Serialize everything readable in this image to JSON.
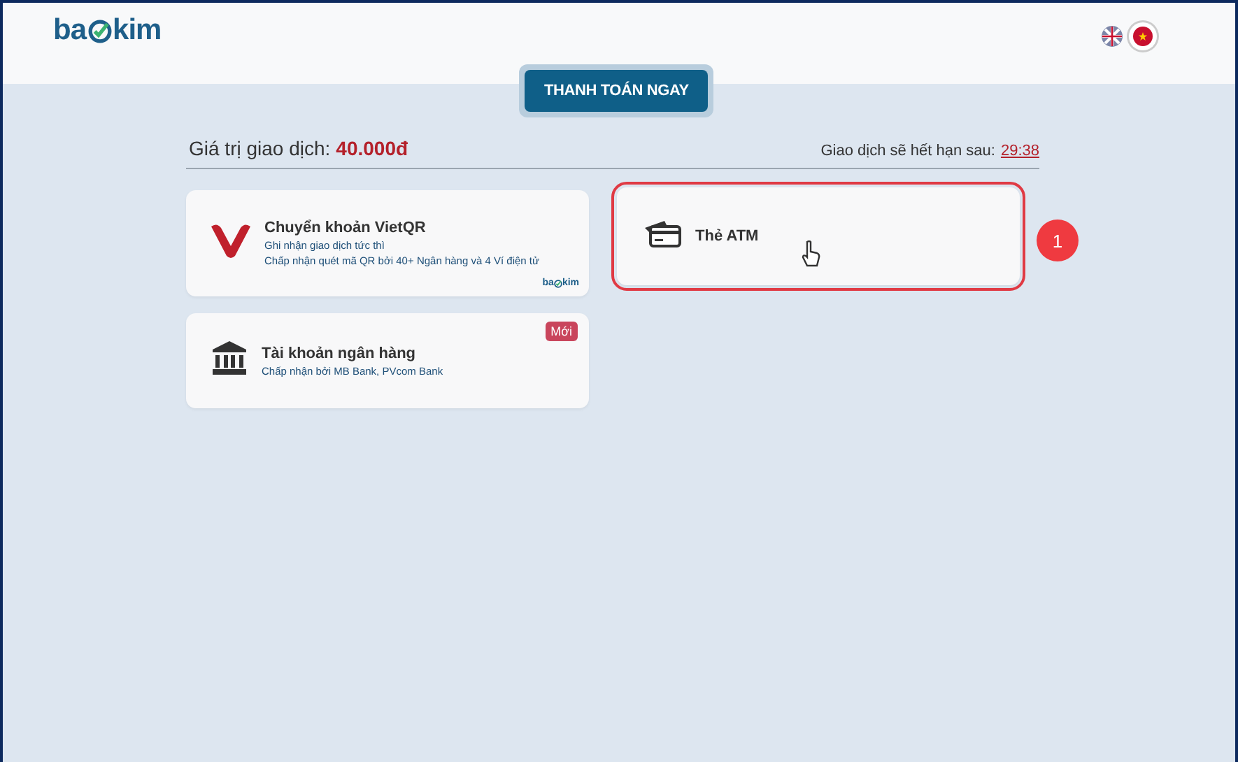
{
  "logo": {
    "before": "ba",
    "after": "kim"
  },
  "languages": [
    {
      "kind": "uk",
      "selected": false
    },
    {
      "kind": "vn",
      "selected": true
    }
  ],
  "pay_button": "THANH TOÁN NGAY",
  "amount": {
    "label": "Giá trị giao dịch:",
    "value": "40.000đ"
  },
  "expiry": {
    "label": "Giao dịch sẽ hết hạn sau:",
    "time": "29:38"
  },
  "methods": [
    {
      "kind": "vietqr",
      "title": "Chuyển khoản VietQR",
      "lines": [
        "Ghi nhận giao dịch tức thì",
        "Chấp nhận quét mã QR bởi 40+ Ngân hàng và 4 Ví điện tử"
      ],
      "brand": {
        "before": "ba",
        "after": "kim"
      },
      "highlighted": false
    },
    {
      "kind": "atm",
      "title": "Thẻ ATM",
      "highlighted": true,
      "step": "1"
    },
    {
      "kind": "bank",
      "title": "Tài khoản ngân hàng",
      "lines": [
        "Chấp nhận bởi MB Bank, PVcom Bank"
      ],
      "badge": "Mới",
      "highlighted": false
    }
  ]
}
